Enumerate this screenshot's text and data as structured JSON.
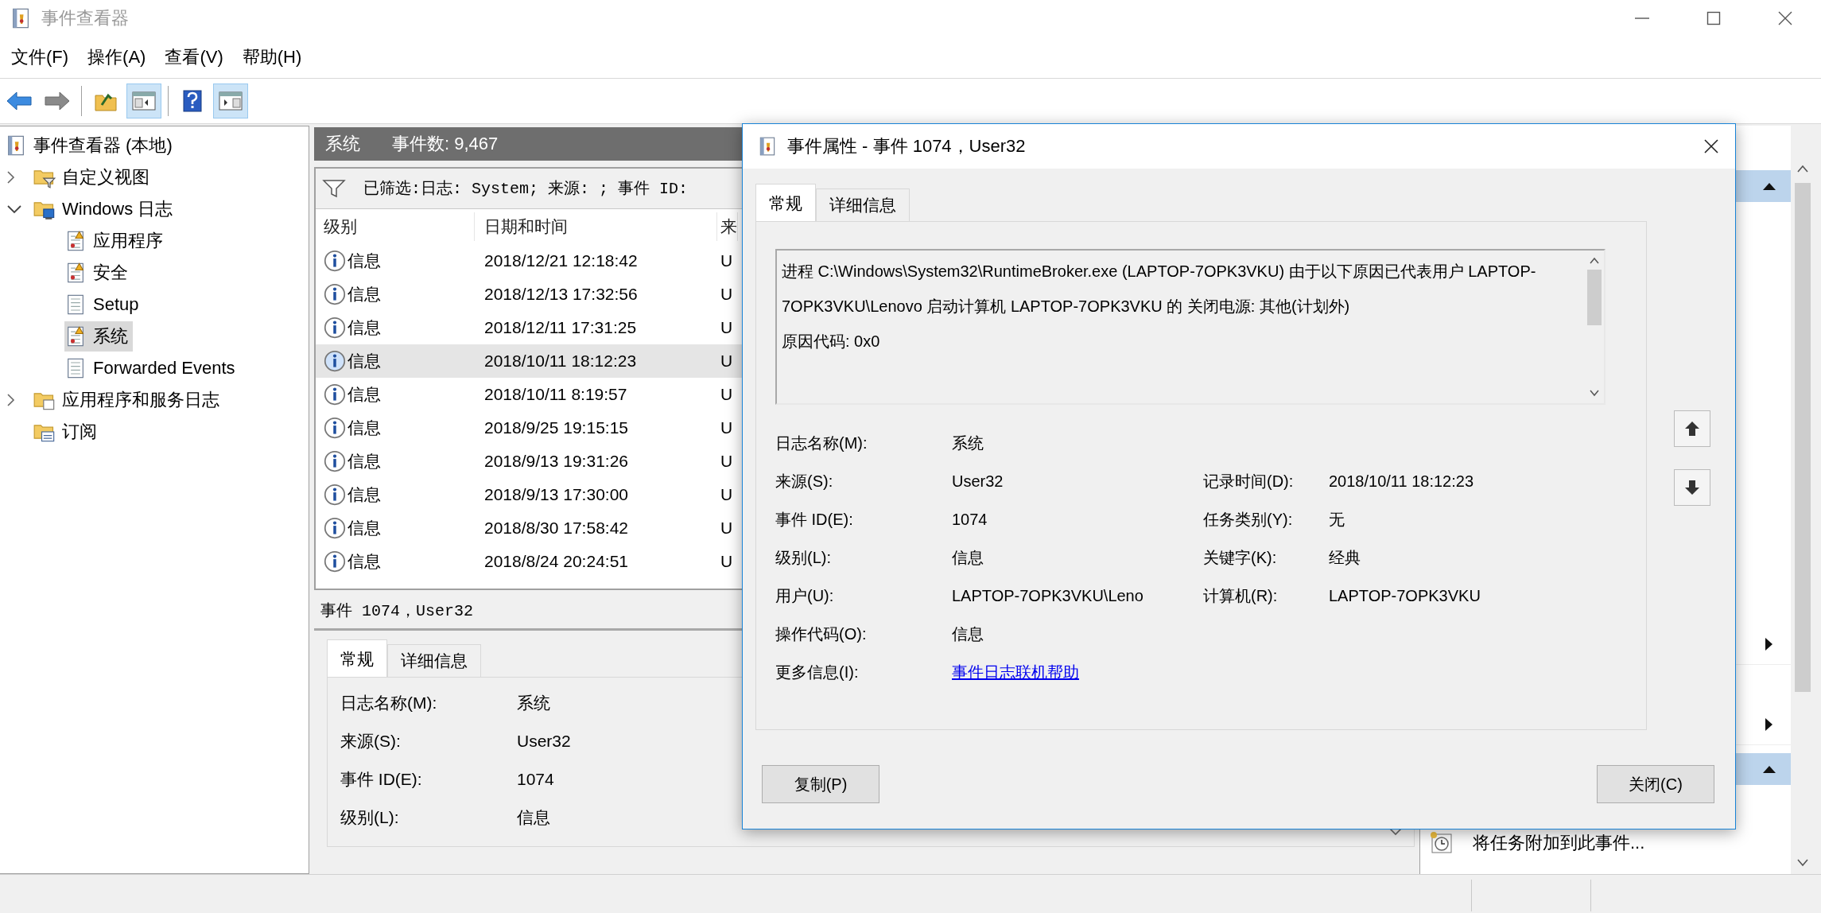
{
  "window": {
    "title": "事件查看器"
  },
  "menu": [
    "文件(F)",
    "操作(A)",
    "查看(V)",
    "帮助(H)"
  ],
  "toolbar": [
    {
      "kind": "back",
      "pressed": false
    },
    {
      "kind": "forward",
      "pressed": false
    },
    {
      "kind": "separator"
    },
    {
      "kind": "folder-up",
      "pressed": false
    },
    {
      "kind": "console-tree",
      "pressed": true
    },
    {
      "kind": "separator"
    },
    {
      "kind": "help",
      "pressed": false
    },
    {
      "kind": "action-pane",
      "pressed": true
    }
  ],
  "tree": {
    "items": [
      {
        "label": "事件查看器 (本地)",
        "kind": "viewer",
        "selected": false,
        "children": [
          {
            "label": "自定义视图",
            "kind": "folder-filter",
            "expanded": false,
            "selected": false
          },
          {
            "label": "Windows 日志",
            "kind": "folder-windows",
            "expanded": true,
            "selected": false,
            "children": [
              {
                "label": "应用程序",
                "kind": "log-warning",
                "selected": false
              },
              {
                "label": "安全",
                "kind": "log-warning",
                "selected": false
              },
              {
                "label": "Setup",
                "kind": "log",
                "selected": false
              },
              {
                "label": "系统",
                "kind": "log-warning",
                "selected": true
              },
              {
                "label": "Forwarded Events",
                "kind": "log",
                "selected": false
              }
            ]
          },
          {
            "label": "应用程序和服务日志",
            "kind": "folder",
            "expanded": false,
            "selected": false
          },
          {
            "label": "订阅",
            "kind": "folder-subscription",
            "selected": false
          }
        ]
      }
    ]
  },
  "pane": {
    "title": "系统",
    "count": "事件数: 9,467",
    "filter": "已筛选:日志: System; 来源: ; 事件 ID:"
  },
  "table": {
    "columns": [
      "级别",
      "日期和时间",
      "来"
    ],
    "rows": [
      {
        "severity": "信息",
        "date_time": "2018/12/21 12:18:42",
        "column_3": "U",
        "selected": false
      },
      {
        "severity": "信息",
        "date_time": "2018/12/13 17:32:56",
        "column_3": "U",
        "selected": false
      },
      {
        "severity": "信息",
        "date_time": "2018/12/11 17:31:25",
        "column_3": "U",
        "selected": false
      },
      {
        "severity": "信息",
        "date_time": "2018/10/11 18:12:23",
        "column_3": "U",
        "selected": true
      },
      {
        "severity": "信息",
        "date_time": "2018/10/11 8:19:57",
        "column_3": "U",
        "selected": false
      },
      {
        "severity": "信息",
        "date_time": "2018/9/25 19:15:15",
        "column_3": "U",
        "selected": false
      },
      {
        "severity": "信息",
        "date_time": "2018/9/13 19:31:26",
        "column_3": "U",
        "selected": false
      },
      {
        "severity": "信息",
        "date_time": "2018/9/13 17:30:00",
        "column_3": "U",
        "selected": false
      },
      {
        "severity": "信息",
        "date_time": "2018/8/30 17:58:42",
        "column_3": "U",
        "selected": false
      },
      {
        "severity": "信息",
        "date_time": "2018/8/24 20:24:51",
        "column_3": "U",
        "selected": false
      }
    ]
  },
  "detail": {
    "title": "事件 1074，User32",
    "tabs": [
      {
        "label": "常规",
        "selected": true
      },
      {
        "label": "详细信息",
        "selected": false
      }
    ],
    "fields": [
      {
        "label": "日志名称(M):",
        "value": "系统"
      },
      {
        "label": "来源(S):",
        "value": "User32"
      },
      {
        "label": "事件 ID(E):",
        "value": "1074"
      },
      {
        "label": "级别(L):",
        "value": "信息"
      }
    ]
  },
  "actions": [
    {
      "kind": "header",
      "expanded": true
    },
    {
      "kind": "submenu"
    },
    {
      "kind": "submenu"
    },
    {
      "kind": "header",
      "expanded": true
    },
    {
      "kind": "task",
      "label": "将任务附加到此事件..."
    }
  ],
  "dialog": {
    "title": "事件属性 - 事件 1074，User32",
    "tabs": [
      {
        "label": "常规",
        "selected": true
      },
      {
        "label": "详细信息",
        "selected": false
      }
    ],
    "message": [
      "进程 C:\\Windows\\System32\\RuntimeBroker.exe (LAPTOP-7OPK3VKU) 由于以下原因已代表用户 LAPTOP-7OPK3VKU\\Lenovo 启动计算机 LAPTOP-7OPK3VKU 的 关闭电源: 其他(计划外)",
      " 原因代码: 0x0"
    ],
    "fields": [
      {
        "kind": "text",
        "label": "日志名称(M):",
        "value": "系统"
      },
      {
        "kind": "text",
        "label": "来源(S):",
        "value": "User32",
        "label_2": "记录时间(D):",
        "value_2": "2018/10/11 18:12:23"
      },
      {
        "kind": "text",
        "label": "事件 ID(E):",
        "value": "1074",
        "label_2": "任务类别(Y):",
        "value_2": "无"
      },
      {
        "kind": "text",
        "label": "级别(L):",
        "value": "信息",
        "label_2": "关键字(K):",
        "value_2": "经典"
      },
      {
        "kind": "text",
        "label": "用户(U):",
        "value": "LAPTOP-7OPK3VKU\\Leno",
        "label_2": "计算机(R):",
        "value_2": "LAPTOP-7OPK3VKU"
      },
      {
        "kind": "text",
        "label": "操作代码(O):",
        "value": "信息"
      },
      {
        "kind": "link",
        "label": "更多信息(I):",
        "value": "事件日志联机帮助"
      }
    ],
    "buttons": [
      "复制(P)",
      "关闭(C)"
    ]
  }
}
